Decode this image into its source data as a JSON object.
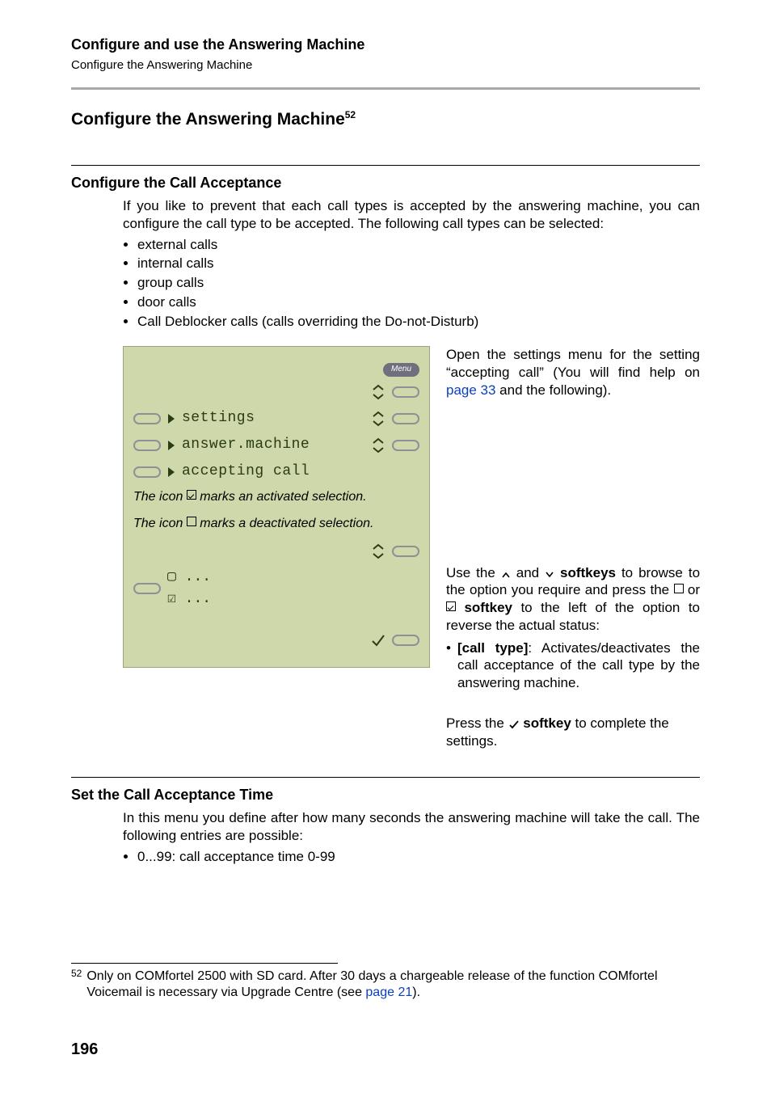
{
  "runhead": {
    "title": "Configure and use the Answering Machine",
    "sub": "Configure the Answering Machine"
  },
  "h2": {
    "before_sup": "Configure",
    "after_sup": " the Answering Machine",
    "supref": "52"
  },
  "sec1": {
    "title": "Configure the Call Acceptance",
    "intro": "If you like to prevent that each call types is accepted by the answering machine, you can configure the call type to be accepted. The following call types can be selected:",
    "bullets": [
      "external calls",
      "internal calls",
      "group calls",
      "door calls",
      "Call Deblocker calls (calls overriding the Do-not-Disturb)"
    ]
  },
  "lcd": {
    "menu_label": "Menu",
    "row_settings": "settings",
    "row_answer": "answer.machine",
    "row_accepting": "accepting call",
    "note1_pre": "The icon ",
    "note1_post": " marks an activated selection.",
    "note2_pre": "The icon ",
    "note2_post": " marks a deactivated selection.",
    "box_unchecked": "▢ ...",
    "box_checked": "☑ ..."
  },
  "desc": {
    "open_pre": "Open the settings menu for the setting “accepting call” (You will find help on ",
    "open_link": "page 33",
    "open_post": " and the following).",
    "use_pre": "Use the ",
    "use_mid1": " and ",
    "use_mid2": " softkeys",
    "use_post1": " to browse to the option you require and press the ",
    "use_post2": " or ",
    "use_post3": " softkey",
    "use_post4": " to the left of the option to reverse the actual status:",
    "bullet_label": "[call type]",
    "bullet_text": ": Activates/deactivates the call acceptance of the call type by the answering machine.",
    "complete_pre": "Press the ",
    "complete_mid": " softkey",
    "complete_post": " to complete the settings."
  },
  "sec2": {
    "title": "Set the Call Acceptance Time",
    "intro": "In this menu you define after how many seconds the answering machine will take the call. The following entries are possible:",
    "bullet": "0...99: call acceptance time 0-99"
  },
  "footnote": {
    "num": "52",
    "text_pre": "Only on COMfortel 2500 with SD card. After 30 days a chargeable release of the function COMfortel Voicemail is necessary via Upgrade Centre (see ",
    "link": "page 21",
    "text_post": ")."
  },
  "page_no": "196"
}
